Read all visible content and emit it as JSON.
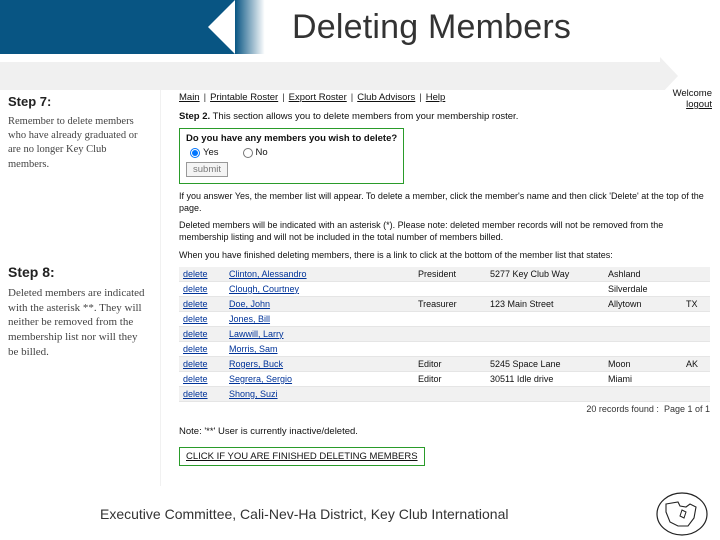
{
  "title": "Deleting Members",
  "steps": {
    "step7": {
      "heading": "Step 7:",
      "body": "Remember to delete members who have already graduated or are no longer Key Club members."
    },
    "step8": {
      "heading": "Step 8:",
      "body": "Deleted members are indicated with the asterisk **. They will neither be removed from the membership list nor will they be billed."
    }
  },
  "welcome": {
    "label": "Welcome",
    "logout": "logout"
  },
  "topnav": [
    "Main",
    "Printable Roster",
    "Export Roster",
    "Club Advisors",
    "Help"
  ],
  "step2Label": "Step 2.",
  "step2Text": "This section allows you to delete members from your membership roster.",
  "question": {
    "prompt": "Do you have any members you wish to delete?",
    "options": {
      "yes": "Yes",
      "no": "No"
    },
    "submit": "submit"
  },
  "instructions": [
    "If you answer Yes, the member list will appear. To delete a member, click the member's name and then click 'Delete' at the top of the page.",
    "Deleted members will be indicated with an asterisk (*). Please note: deleted member records will not be removed from the membership listing and will not be included in the total number of members billed.",
    "When you have finished deleting members, there is a link to click at the bottom of the member list that states:"
  ],
  "members": [
    {
      "del": "delete",
      "name": "Clinton, Alessandro",
      "role": "President",
      "addr": "5277 Key Club Way",
      "city": "Ashland",
      "state": ""
    },
    {
      "del": "delete",
      "name": "Clough, Courtney",
      "role": "",
      "addr": "",
      "city": "Silverdale",
      "state": ""
    },
    {
      "del": "delete",
      "name": "Doe, John",
      "role": "Treasurer",
      "addr": "123 Main Street",
      "city": "Allytown",
      "state": "TX"
    },
    {
      "del": "delete",
      "name": "Jones, Bill",
      "role": "",
      "addr": "",
      "city": "",
      "state": ""
    },
    {
      "del": "delete",
      "name": "Lawwill, Larry",
      "role": "",
      "addr": "",
      "city": "",
      "state": ""
    },
    {
      "del": "delete",
      "name": "Morris, Sam",
      "role": "",
      "addr": "",
      "city": "",
      "state": ""
    },
    {
      "del": "delete",
      "name": "Rogers, Buck",
      "role": "Editor",
      "addr": "5245 Space Lane",
      "city": "Moon",
      "state": "AK"
    },
    {
      "del": "delete",
      "name": "Segrera, Sergio",
      "role": "Editor",
      "addr": "30511 Idle drive",
      "city": "Miami",
      "state": ""
    },
    {
      "del": "delete",
      "name": "Shong, Suzi",
      "role": "",
      "addr": "",
      "city": "",
      "state": ""
    }
  ],
  "pageMeta": {
    "recordsFound": "20 records found :",
    "page": "Page 1 of 1"
  },
  "note": "Note: '**' User is currently inactive/deleted.",
  "finishLink": "CLICK IF YOU ARE FINISHED DELETING MEMBERS",
  "footer": "Executive Committee, Cali-Nev-Ha District, Key Club International"
}
